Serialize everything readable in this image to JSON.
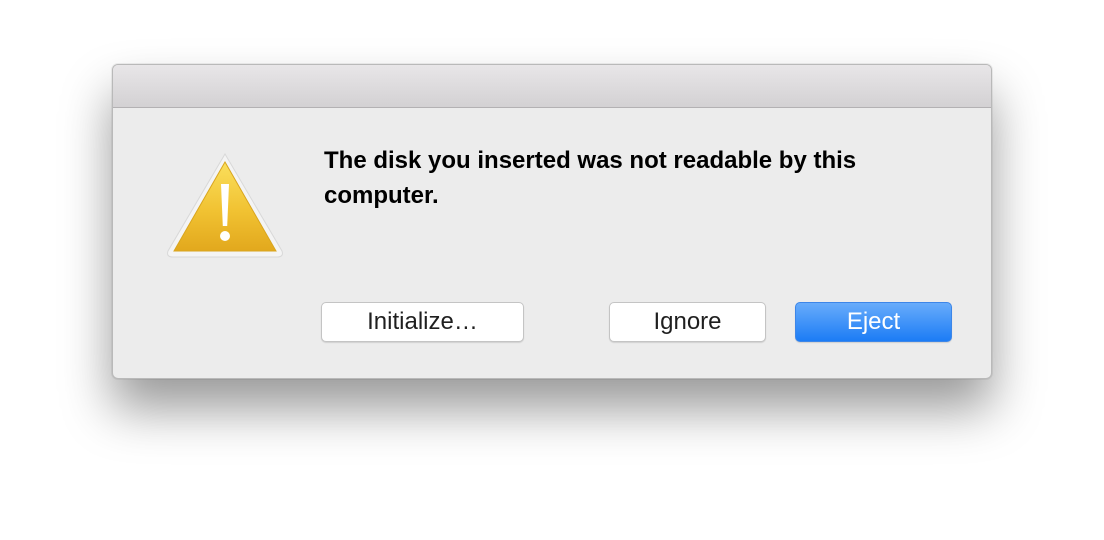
{
  "dialog": {
    "message": "The disk you inserted was not readable by this computer.",
    "icon": "warning-triangle-icon",
    "buttons": {
      "initialize": "Initialize…",
      "ignore": "Ignore",
      "eject": "Eject"
    },
    "default_button": "eject"
  },
  "colors": {
    "dialog_background": "#ececec",
    "titlebar": "#dcdadc",
    "accent_button": "#2a84f7",
    "warning_yellow": "#f2c33a"
  }
}
